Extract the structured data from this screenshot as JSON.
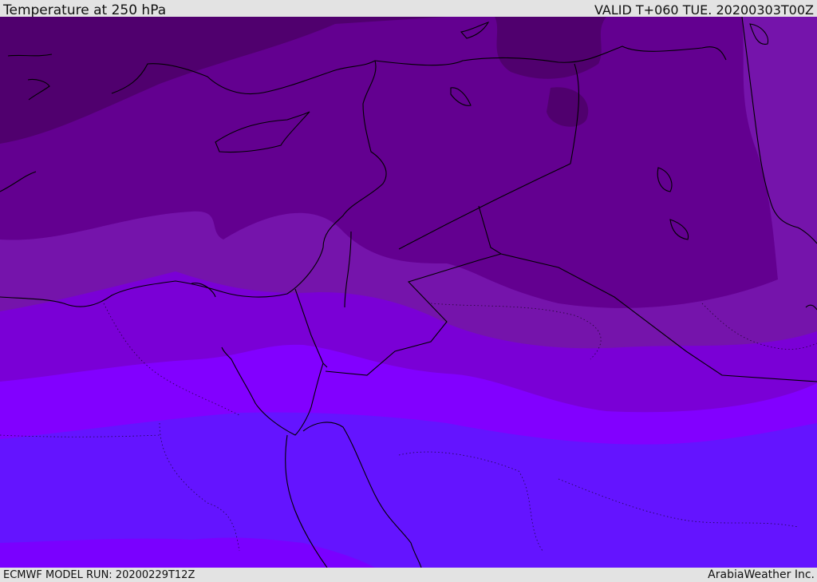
{
  "header": {
    "title": "Temperature at 250 hPa",
    "valid": "VALID T+060 TUE. 20200303T00Z"
  },
  "footer": {
    "model_run": "ECMWF MODEL RUN: 20200229T12Z",
    "credit": "ArabiaWeather Inc."
  },
  "colors": {
    "band_coldest": "#50006e",
    "band_2": "#630090",
    "band_3": "#7514ab",
    "band_4": "#7a00d6",
    "band_5": "#8200ff",
    "band_6": "#6414ff",
    "band_warmest": "#7a00ff",
    "coastline": "#000000",
    "frame": "#e3e3e3"
  }
}
